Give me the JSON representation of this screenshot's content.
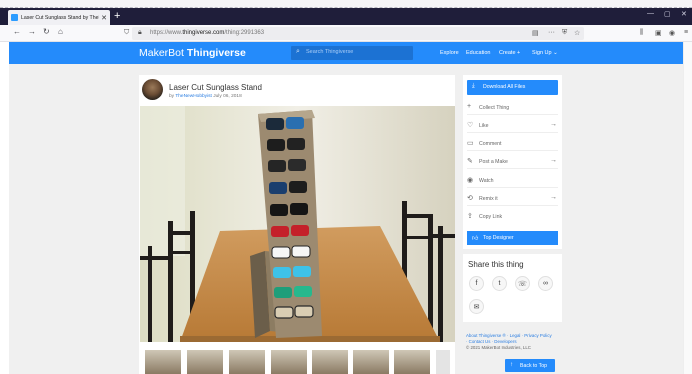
{
  "browser": {
    "tab_title": "Laser Cut Sunglass Stand by TheNe",
    "tab_close": "✕",
    "new_tab": "+",
    "url_prefix": "https://www.",
    "url_domain": "thingiverse.com",
    "url_path": "/thing:2991363",
    "window_controls": [
      "—",
      "▢",
      "✕"
    ]
  },
  "site": {
    "logo_maker": "MakerBot",
    "logo_thing": "Thingiverse",
    "search_placeholder": "Search Thingiverse",
    "nav": [
      "Explore",
      "Education",
      "Create",
      "Sign Up"
    ]
  },
  "thing": {
    "title": "Laser Cut Sunglass Stand",
    "by_prefix": "by",
    "author": "TheNewHobbyist",
    "date": "July 06, 2018"
  },
  "actions": {
    "download": "Download All Files",
    "items": [
      {
        "icon": "plus-icon",
        "glyph": "+",
        "label": "Collect Thing",
        "arrow": ""
      },
      {
        "icon": "heart-icon",
        "glyph": "♡",
        "label": "Like",
        "arrow": "→"
      },
      {
        "icon": "comment-icon",
        "glyph": "▭",
        "label": "Comment",
        "arrow": ""
      },
      {
        "icon": "make-icon",
        "glyph": "✎",
        "label": "Post a Make",
        "arrow": "→"
      },
      {
        "icon": "eye-icon",
        "glyph": "◉",
        "label": "Watch",
        "arrow": ""
      },
      {
        "icon": "remix-icon",
        "glyph": "⟲",
        "label": "Remix it",
        "arrow": "→"
      },
      {
        "icon": "share-icon",
        "glyph": "⇪",
        "label": "Copy Link",
        "arrow": ""
      }
    ],
    "top_designer": "Top Designer"
  },
  "share": {
    "title": "Share this thing",
    "buttons": [
      {
        "icon": "facebook-icon",
        "glyph": "f"
      },
      {
        "icon": "twitter-icon",
        "glyph": "t"
      },
      {
        "icon": "whatsapp-icon",
        "glyph": "☏"
      },
      {
        "icon": "link-icon",
        "glyph": "∞"
      },
      {
        "icon": "email-icon",
        "glyph": "✉"
      }
    ]
  },
  "footer": {
    "line1": "About Thingiverse ® · Legal · Privacy Policy",
    "line2": "· Contact Us · Developers",
    "line3": "© 2021 MakerBot Industries, LLC",
    "back_to_top": "Back to Top"
  },
  "colors": {
    "brand_blue": "#248bfb",
    "tab_bar": "#1f1e3a"
  }
}
